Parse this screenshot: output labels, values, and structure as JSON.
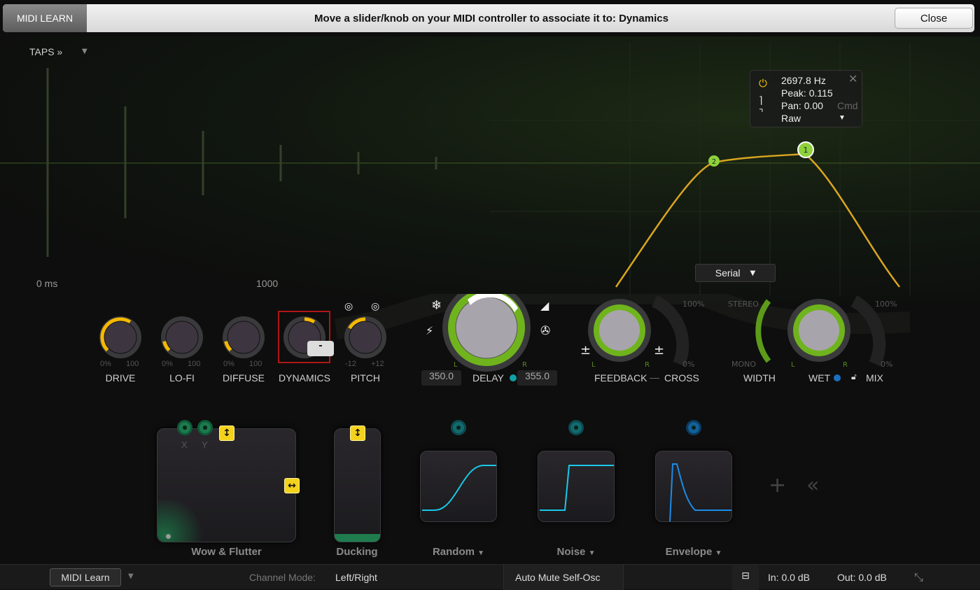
{
  "midi_bar": {
    "learn_label": "MIDI LEARN",
    "message": "Move a slider/knob on your MIDI controller to associate it to: Dynamics",
    "close_label": "Close"
  },
  "taps": {
    "label": "TAPS »",
    "axis_start": "0 ms",
    "axis_mid": "1000"
  },
  "eq_popup": {
    "freq": "2697.8 Hz",
    "peak": "Peak: 0.115",
    "pan": "Pan: 0.00",
    "modifier": "Cmd",
    "mode": "Raw",
    "nodes": [
      "1",
      "2"
    ]
  },
  "routing": {
    "selected": "Serial"
  },
  "knobs": [
    {
      "label": "DRIVE",
      "min": "0%",
      "max": "100",
      "value": 0.62
    },
    {
      "label": "LO-FI",
      "min": "0%",
      "max": "100",
      "value": 0.12
    },
    {
      "label": "DIFFUSE",
      "min": "0%",
      "max": "100",
      "value": 0.12
    },
    {
      "label": "DYNAMICS",
      "min": "",
      "max": "",
      "value": 0.62,
      "tooltip": "-"
    },
    {
      "label": "PITCH",
      "min": "-12",
      "max": "+12",
      "value": 0.5
    }
  ],
  "delay": {
    "label": "DELAY",
    "left": "350.0",
    "right": "355.0",
    "l": "L",
    "r": "R"
  },
  "feedback": {
    "label": "FEEDBACK",
    "cross_label": "CROSS",
    "max": "100%",
    "min": "0%",
    "l": "L",
    "r": "R"
  },
  "width": {
    "label": "WIDTH",
    "top": "STEREO",
    "bottom": "MONO"
  },
  "wet": {
    "label": "WET",
    "mix_label": "MIX",
    "max": "100%",
    "min": "0%",
    "l": "L",
    "r": "R"
  },
  "modulators": [
    {
      "label": "Wow & Flutter",
      "x": "X",
      "y": "Y"
    },
    {
      "label": "Ducking"
    },
    {
      "label": "Random"
    },
    {
      "label": "Noise"
    },
    {
      "label": "Envelope"
    }
  ],
  "footer": {
    "midi_learn": "MIDI Learn",
    "channel_mode_label": "Channel Mode:",
    "channel_mode": "Left/Right",
    "auto_mute": "Auto Mute Self-Osc",
    "in": "In:  0.0 dB",
    "out": "Out:  0.0 dB"
  },
  "colors": {
    "accent_green": "#7cc21e",
    "knob_yellow": "#f5b800",
    "eq_curve": "#d9a520",
    "mod_cyan": "#19c8e8"
  }
}
